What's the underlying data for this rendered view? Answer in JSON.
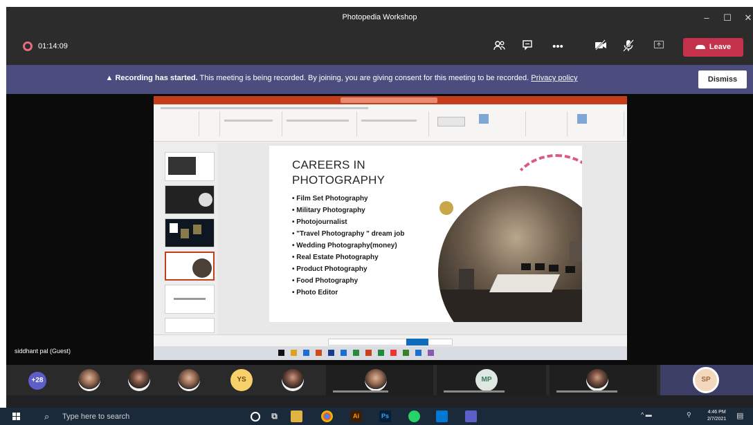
{
  "window": {
    "title": "Photopedia Workshop"
  },
  "controls": {
    "timer": "01:14:09",
    "leave_label": "Leave"
  },
  "banner": {
    "bold": "Recording has started.",
    "message": " This meeting is being recorded. By joining, you are giving consent for this meeting to be recorded. ",
    "privacy_link": "Privacy policy",
    "dismiss_label": "Dismiss"
  },
  "slide": {
    "title_line1": "CAREERS IN",
    "title_line2": "PHOTOGRAPHY",
    "bullets": [
      "Film Set Photography",
      "Military Photography",
      "Photojournalist",
      "\"Travel Photography \" dream job",
      "Wedding Photography(money)",
      "Real Estate Photography",
      "Product Photography",
      "Food Photography",
      "Photo Editor"
    ]
  },
  "presenter": {
    "name": "siddhant pal (Guest)"
  },
  "participants": {
    "overflow_count": "+28",
    "initials": [
      "YS",
      "MP",
      "SP"
    ]
  },
  "taskbar": {
    "search_placeholder": "Type here to search",
    "time": "4:46 PM",
    "date": "2/7/2021"
  },
  "colors": {
    "leave": "#c4314b",
    "banner": "#4a4d7e",
    "powerpoint": "#c43e1c",
    "count_avatar": "#5b5fc7"
  }
}
